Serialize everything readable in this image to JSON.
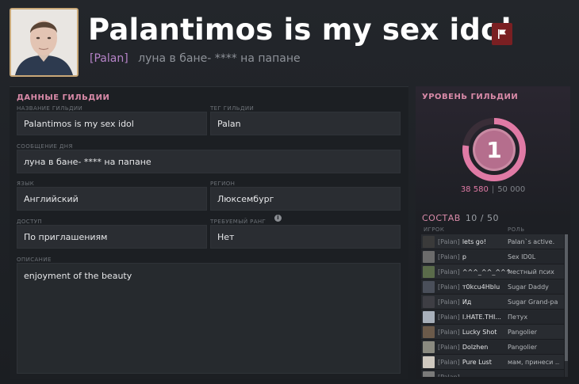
{
  "header": {
    "guild_name": "Palantimos is my sex idol",
    "tag": "[Palan]",
    "motd": "луна в бане- **** на папане",
    "flag_icon": "flag-icon"
  },
  "guild_data": {
    "title": "ДАННЫЕ ГИЛЬДИИ",
    "name_label": "НАЗВАНИЕ ГИЛЬДИИ",
    "name_value": "Palantimos is my sex idol",
    "tag_label": "ТЕГ ГИЛЬДИИ",
    "tag_value": "Palan",
    "motd_label": "СООБЩЕНИЕ ДНЯ",
    "motd_value": "луна в бане- **** на папане",
    "language_label": "ЯЗЫК",
    "language_value": "Английский",
    "region_label": "РЕГИОН",
    "region_value": "Люксембург",
    "access_label": "ДОСТУП",
    "access_value": "По приглашениям",
    "rank_label": "ТРЕБУЕМЫЙ РАНГ",
    "rank_value": "Нет",
    "description_label": "ОПИСАНИЕ",
    "description_value": "enjoyment of the beauty"
  },
  "guild_level": {
    "title": "УРОВЕНЬ ГИЛЬДИИ",
    "level": "1",
    "xp_current": "38 580",
    "xp_max": "50 000",
    "progress_fraction": 0.7716,
    "accent_color": "#e07aa5"
  },
  "roster": {
    "title": "СОСТАВ",
    "count": "10 / 50",
    "col_player": "ИГРОК",
    "col_role": "РОЛЬ",
    "members": [
      {
        "tag": "[Palan]",
        "name": "lets go!",
        "role": "Palan`s active."
      },
      {
        "tag": "[Palan]",
        "name": "p",
        "role": "Sex ID0L"
      },
      {
        "tag": "[Palan]",
        "name": "^^^_^^_^^^",
        "role": "местный псих"
      },
      {
        "tag": "[Palan]",
        "name": "т0kcu4Hblu",
        "role": "Sugar Daddy"
      },
      {
        "tag": "[Palan]",
        "name": "Ид",
        "role": "Sugar Grand-pa"
      },
      {
        "tag": "[Palan]",
        "name": "I.HATE.THI...",
        "role": "Петух"
      },
      {
        "tag": "[Palan]",
        "name": "Lucky Shot",
        "role": "Pangolier"
      },
      {
        "tag": "[Palan]",
        "name": "Dolzhen",
        "role": "Pangolier"
      },
      {
        "tag": "[Palan]",
        "name": "Pure Lust",
        "role": "мам, принеси ..."
      },
      {
        "tag": "[Palan]",
        "name": "",
        "role": ""
      }
    ]
  }
}
